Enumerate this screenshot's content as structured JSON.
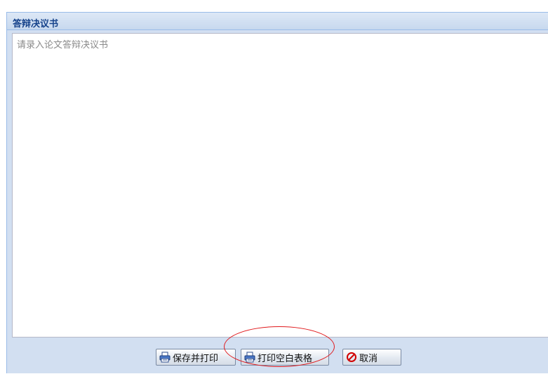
{
  "panel": {
    "title": "答辩决议书"
  },
  "editor": {
    "placeholder": "请录入论文答辩决议书",
    "value": ""
  },
  "toolbar": {
    "save_print_label": "保存并打印",
    "print_blank_label": "打印空白表格",
    "cancel_label": "取消"
  },
  "icons": {
    "save_print": "printer-icon",
    "print_blank": "printer-icon",
    "cancel": "cancel-icon"
  },
  "colors": {
    "title": "#15428b",
    "panel_background": "#d2dff1",
    "panel_border": "#99bbe8",
    "annotation": "#e0191c",
    "cancel_icon": "#d10000"
  }
}
